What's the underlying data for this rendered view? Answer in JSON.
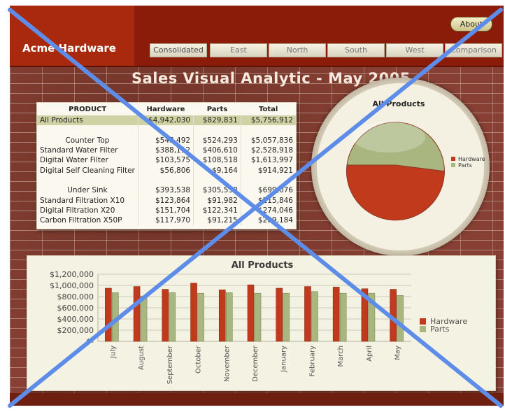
{
  "app": {
    "brand": "Acme Hardware",
    "about": "About",
    "tabs": [
      "Consolidated",
      "East",
      "North",
      "South",
      "West",
      "Comparison"
    ],
    "title": "Sales Visual Analytic - May 2005"
  },
  "table": {
    "headers": [
      "PRODUCT",
      "Hardware",
      "Parts",
      "Total"
    ],
    "rows": [
      {
        "name": "All Products",
        "hardware": "$4,942,030",
        "parts": "$829,831",
        "total": "$5,756,912",
        "style": "highlight"
      },
      {
        "name": "",
        "hardware": "",
        "parts": "",
        "total": "",
        "style": "blank"
      },
      {
        "name": "Counter Top",
        "hardware": "$548,492",
        "parts": "$524,293",
        "total": "$5,057,836",
        "style": "category"
      },
      {
        "name": "Standard Water Filter",
        "hardware": "$388,112",
        "parts": "$406,610",
        "total": "$2,528,918",
        "style": "item"
      },
      {
        "name": "Digital Water Filter",
        "hardware": "$103,575",
        "parts": "$108,518",
        "total": "$1,613,997",
        "style": "item"
      },
      {
        "name": "Digital Self Cleaning Filter",
        "hardware": "$56,806",
        "parts": "$9,164",
        "total": "$914,921",
        "style": "item"
      },
      {
        "name": "",
        "hardware": "",
        "parts": "",
        "total": "",
        "style": "blank"
      },
      {
        "name": "Under Sink",
        "hardware": "$393,538",
        "parts": "$305,538",
        "total": "$699,076",
        "style": "category"
      },
      {
        "name": "Standard Filtration X10",
        "hardware": "$123,864",
        "parts": "$91,982",
        "total": "$215,846",
        "style": "item"
      },
      {
        "name": "Digital Filtration X20",
        "hardware": "$151,704",
        "parts": "$122,341",
        "total": "$274,046",
        "style": "item"
      },
      {
        "name": "Carbon Filtration X50P",
        "hardware": "$117,970",
        "parts": "$91,215",
        "total": "$209,184",
        "style": "item"
      }
    ]
  },
  "colors": {
    "hardware": "#c23a1c",
    "parts": "#a9b67f",
    "overlay": "#5d8de8"
  },
  "chart_data": [
    {
      "type": "pie",
      "title": "All Products",
      "categories": [
        "Hardware",
        "Parts"
      ],
      "values": [
        52,
        48
      ],
      "legend": "right"
    },
    {
      "type": "bar",
      "title": "All Products",
      "categories": [
        "July",
        "August",
        "September",
        "October",
        "November",
        "December",
        "January",
        "February",
        "March",
        "April",
        "May"
      ],
      "series": [
        {
          "name": "Hardware",
          "values": [
            950000,
            980000,
            930000,
            1040000,
            920000,
            1010000,
            950000,
            980000,
            970000,
            940000,
            930000
          ]
        },
        {
          "name": "Parts",
          "values": [
            870000,
            810000,
            870000,
            860000,
            870000,
            860000,
            860000,
            890000,
            860000,
            860000,
            820000
          ]
        }
      ],
      "yticks": [
        "$1,200,000",
        "$1,000,000",
        "$800,000",
        "$600,000",
        "$400,000",
        "$200,000",
        "$-"
      ],
      "ylim": [
        0,
        1200000
      ],
      "legend": "right",
      "grid": true
    }
  ]
}
